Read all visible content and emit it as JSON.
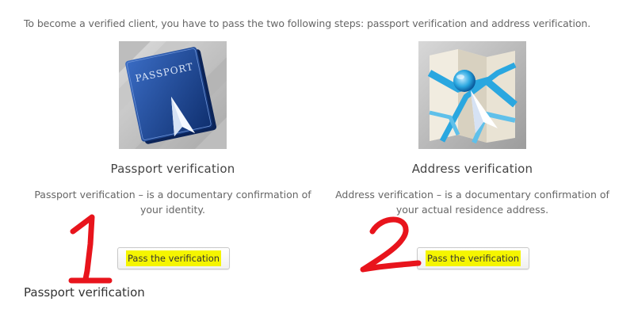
{
  "intro_text": "To become a verified client, you have to pass the two following steps: passport verification and address verification.",
  "cards": [
    {
      "image_word": "PASSPORT",
      "title": "Passport verification",
      "description": "Passport verification – is a documentary confirmation of your identity.",
      "button_label": "Pass the verification",
      "annotation": "1"
    },
    {
      "title": "Address verification",
      "description": "Address verification – is a documentary confirmation of your actual residence address.",
      "button_label": "Pass the verification",
      "annotation": "2"
    }
  ],
  "section_heading": "Passport verification",
  "colors": {
    "highlight": "#f5f500",
    "annotation_red": "#e8141c",
    "passport_blue": "#1e4a94",
    "map_accent": "#2aa7e0"
  },
  "icons": [
    "passport-book-icon",
    "map-location-icon",
    "paper-plane-icon"
  ]
}
